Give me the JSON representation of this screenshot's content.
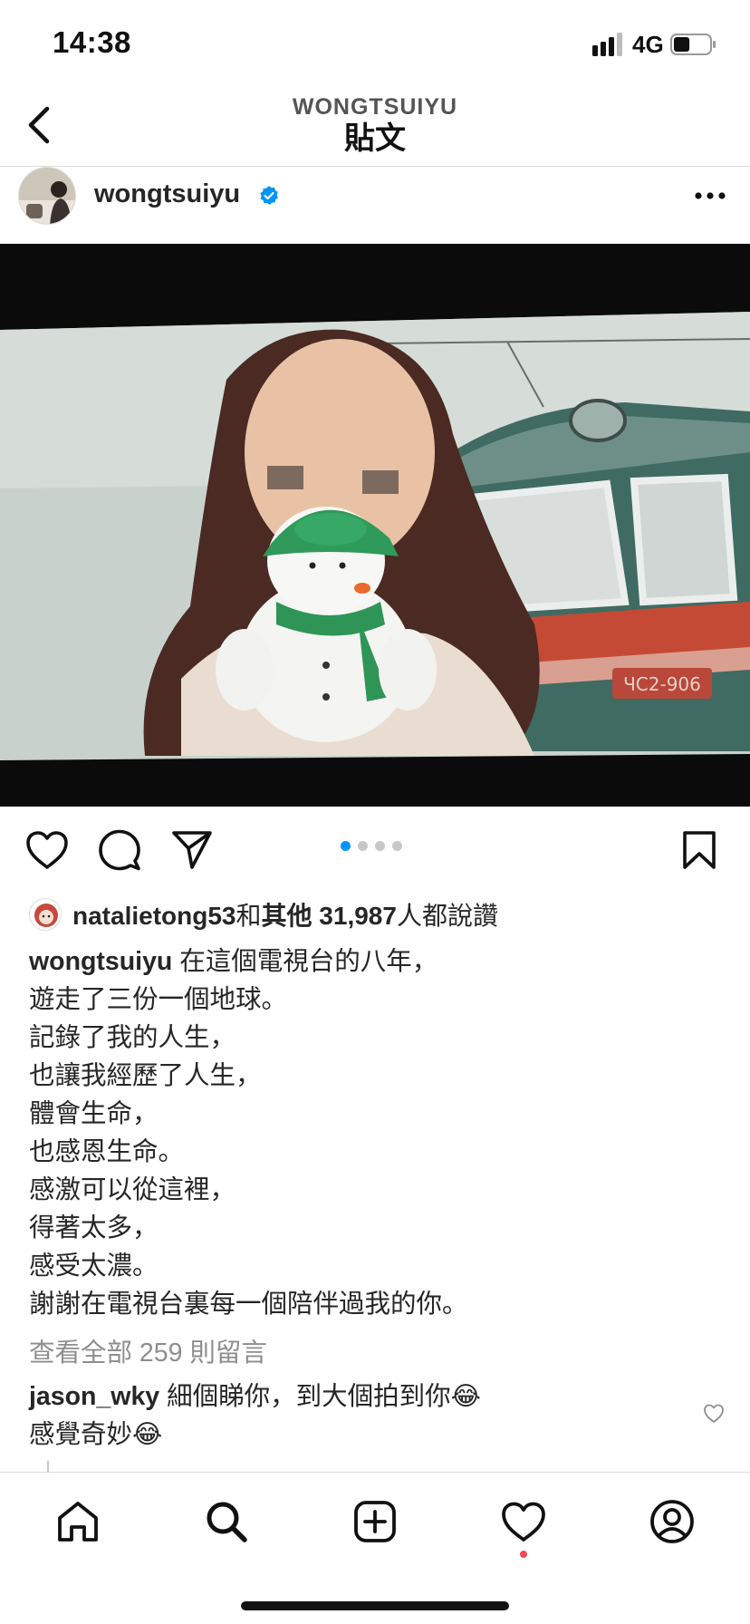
{
  "status_bar": {
    "time": "14:38",
    "network": "4G",
    "battery_level": 0.45
  },
  "nav": {
    "subtitle": "WONGTSUIYU",
    "title": "貼文"
  },
  "post": {
    "username": "wongtsuiyu",
    "verified": true,
    "carousel": {
      "count": 4,
      "active_index": 0
    },
    "image_text": "ЧС2-906",
    "likes": {
      "liker": "natalietong53",
      "connector": "和",
      "others_label": "其他",
      "count": "31,987",
      "suffix": "人都說讚"
    },
    "caption": {
      "author": "wongtsuiyu",
      "lines": [
        "在這個電視台的八年，",
        "遊走了三份一個地球。",
        "記錄了我的人生，",
        "也讓我經歷了人生，",
        "體會生命，",
        "也感恩生命。",
        "感激可以從這裡，",
        "得著太多，",
        "感受太濃。",
        "謝謝在電視台裏每一個陪伴過我的你。"
      ]
    },
    "view_comments": "查看全部 259 則留言",
    "comment": {
      "user": "jason_wky",
      "line1": "細個睇你，到大個拍到你😂",
      "line2": "感覺奇妙😂"
    }
  },
  "icons": {
    "back": "chevron-left-icon",
    "verified": "verified-badge-icon",
    "more": "more-horizontal-icon",
    "like": "heart-icon",
    "comment": "comment-icon",
    "share": "send-icon",
    "save": "bookmark-icon",
    "home": "home-icon",
    "search": "search-icon",
    "create": "add-post-icon",
    "activity": "heart-icon",
    "profile": "profile-icon"
  },
  "colors": {
    "accent": "#0095f6",
    "text": "#262626",
    "muted": "#8e8e8e",
    "notification": "#ed4956"
  }
}
